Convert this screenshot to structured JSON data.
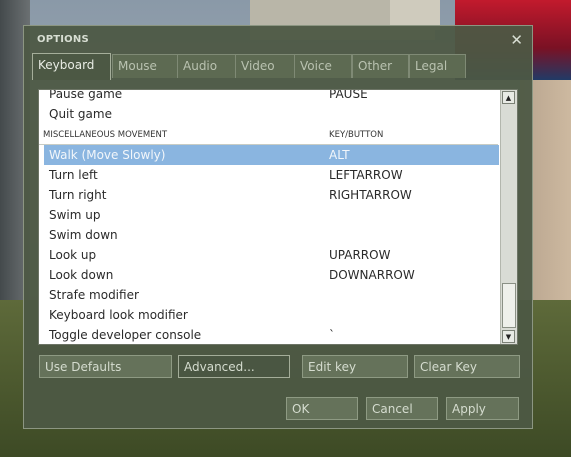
{
  "window": {
    "title": "OPTIONS",
    "close_glyph": "✕"
  },
  "tabs": [
    {
      "label": "Keyboard",
      "active": true
    },
    {
      "label": "Mouse"
    },
    {
      "label": "Audio"
    },
    {
      "label": "Video"
    },
    {
      "label": "Voice"
    },
    {
      "label": "Other"
    },
    {
      "label": "Legal"
    }
  ],
  "list": {
    "rows": [
      {
        "action": "Pause game",
        "key": "PAUSE"
      },
      {
        "action": "Quit game",
        "key": ""
      }
    ],
    "section": {
      "action": "MISCELLANEOUS MOVEMENT",
      "key": "KEY/BUTTON"
    },
    "selected": {
      "action": "Walk (Move Slowly)",
      "key": "ALT"
    },
    "rows2": [
      {
        "action": "Turn left",
        "key": "LEFTARROW"
      },
      {
        "action": "Turn right",
        "key": "RIGHTARROW"
      },
      {
        "action": "Swim up",
        "key": ""
      },
      {
        "action": "Swim down",
        "key": ""
      },
      {
        "action": "Look up",
        "key": "UPARROW"
      },
      {
        "action": "Look down",
        "key": "DOWNARROW"
      },
      {
        "action": "Strafe modifier",
        "key": ""
      },
      {
        "action": "Keyboard look modifier",
        "key": ""
      },
      {
        "action": "Toggle developer console",
        "key": "`"
      }
    ]
  },
  "buttons": {
    "use_defaults": "Use Defaults",
    "advanced": "Advanced...",
    "edit_key": "Edit key",
    "clear_key": "Clear Key",
    "ok": "OK",
    "cancel": "Cancel",
    "apply": "Apply"
  },
  "icons": {
    "scroll_up": "▲",
    "scroll_down": "▼"
  }
}
